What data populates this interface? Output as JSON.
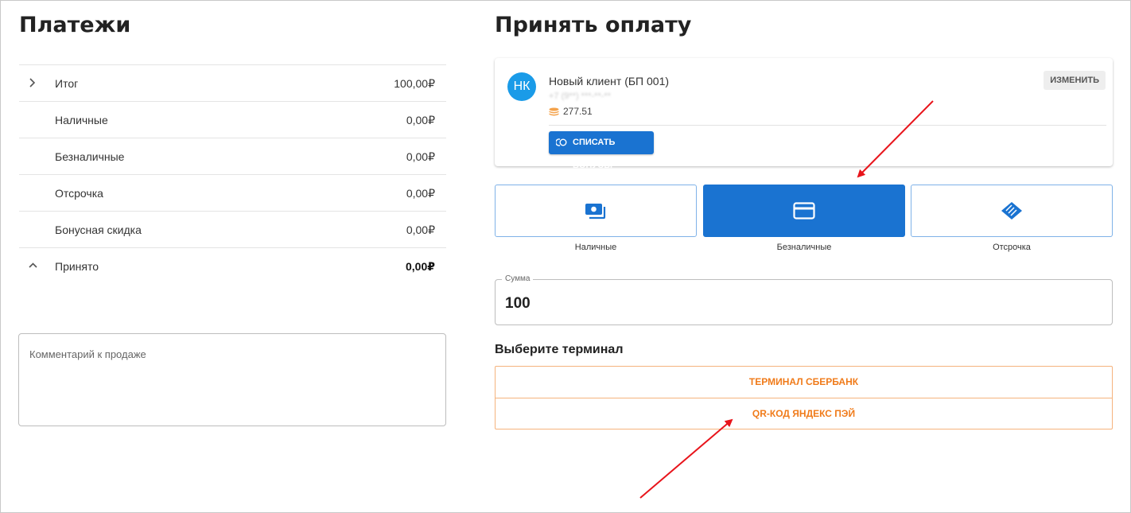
{
  "colors": {
    "accent": "#1a73d1",
    "avatar": "#1a9be8",
    "terminal": "#f07b1a",
    "coins": "#f4a24a",
    "annotation_arrow": "#e8141b"
  },
  "payments": {
    "title": "Платежи",
    "rows": [
      {
        "icon": "chevron-right-icon",
        "label": "Итог",
        "value": "100,00₽"
      },
      {
        "label": "Наличные",
        "value": "0,00₽"
      },
      {
        "label": "Безналичные",
        "value": "0,00₽"
      },
      {
        "label": "Отсрочка",
        "value": "0,00₽"
      },
      {
        "label": "Бонусная скидка",
        "value": "0,00₽"
      },
      {
        "icon": "chevron-up-icon",
        "label": "Принято",
        "value": "0,00₽"
      }
    ],
    "comment_placeholder": "Комментарий к продаже"
  },
  "accept": {
    "title": "Принять оплату",
    "client": {
      "initials": "НК",
      "name": "Новый клиент (БП 001)",
      "phone_masked": "+7 (9**) ***-**-**",
      "bonus_balance": "277.51",
      "change_label": "ИЗМЕНИТЬ",
      "write_off_label": "СПИСАТЬ БОНУСЫ"
    },
    "methods": [
      {
        "label": "Наличные",
        "icon": "cash-icon",
        "active": false
      },
      {
        "label": "Безналичные",
        "icon": "card-icon",
        "active": true
      },
      {
        "label": "Отсрочка",
        "icon": "handshake-icon",
        "active": false
      }
    ],
    "amount": {
      "label": "Сумма",
      "value": "100"
    },
    "terminal_title": "Выберите терминал",
    "terminals": [
      "ТЕРМИНАЛ СБЕРБАНК",
      "QR-КОД ЯНДЕКС ПЭЙ"
    ]
  }
}
